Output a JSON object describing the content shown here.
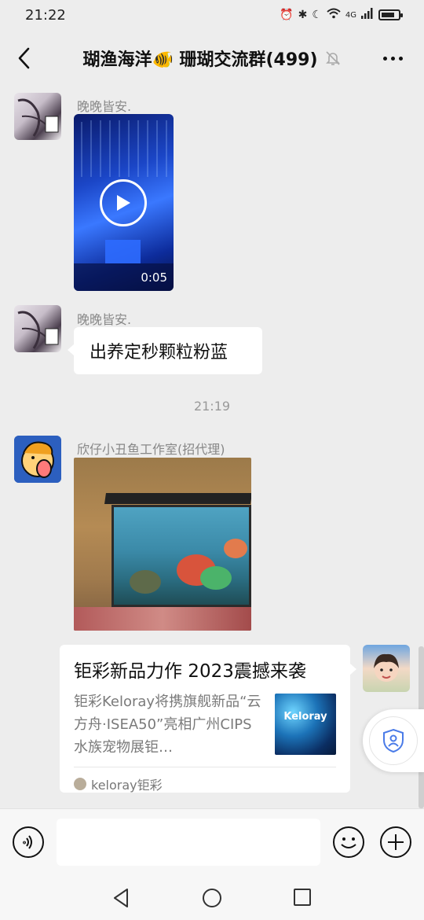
{
  "status_bar": {
    "time": "21:22",
    "network": "4G",
    "icons": [
      "alarm-icon",
      "bluetooth-icon",
      "moon-icon",
      "wifi-icon",
      "signal-icon",
      "battery-icon"
    ]
  },
  "header": {
    "title": "瑚渔海洋🐠 珊瑚交流群(499)",
    "icons": [
      "back-arrow-icon",
      "mute-bell-icon",
      "more-dots-icon"
    ]
  },
  "messages": [
    {
      "sender": "晚晚皆安.",
      "type": "video",
      "duration": "0:05"
    },
    {
      "sender": "晚晚皆安.",
      "type": "text",
      "text": "出养定秒颗粒粉蓝"
    },
    {
      "type": "time",
      "text": "21:19"
    },
    {
      "sender": "欣仔小丑鱼工作室(招代理)",
      "type": "image"
    },
    {
      "sender": "self",
      "type": "article-card",
      "title": "钜彩新品力作 2023震撼来袭",
      "description": "钜彩Keloray将携旗舰新品“云方舟·ISEA50”亮相广州CIPS水族宠物展钜…",
      "thumb_text": "Keloray",
      "source": "keloray钜彩"
    }
  ],
  "composer": {
    "placeholder": "",
    "value": "",
    "icons": [
      "voice-icon",
      "emoji-icon",
      "plus-icon"
    ]
  },
  "nav": {
    "icons": [
      "nav-back-icon",
      "nav-home-icon",
      "nav-recent-icon"
    ]
  },
  "floating_button": {
    "icon": "shield-user-icon"
  },
  "colors": {
    "background": "#ededed",
    "bubble": "#ffffff",
    "meta_text": "#888888",
    "accent_blue": "#4a7be8"
  }
}
